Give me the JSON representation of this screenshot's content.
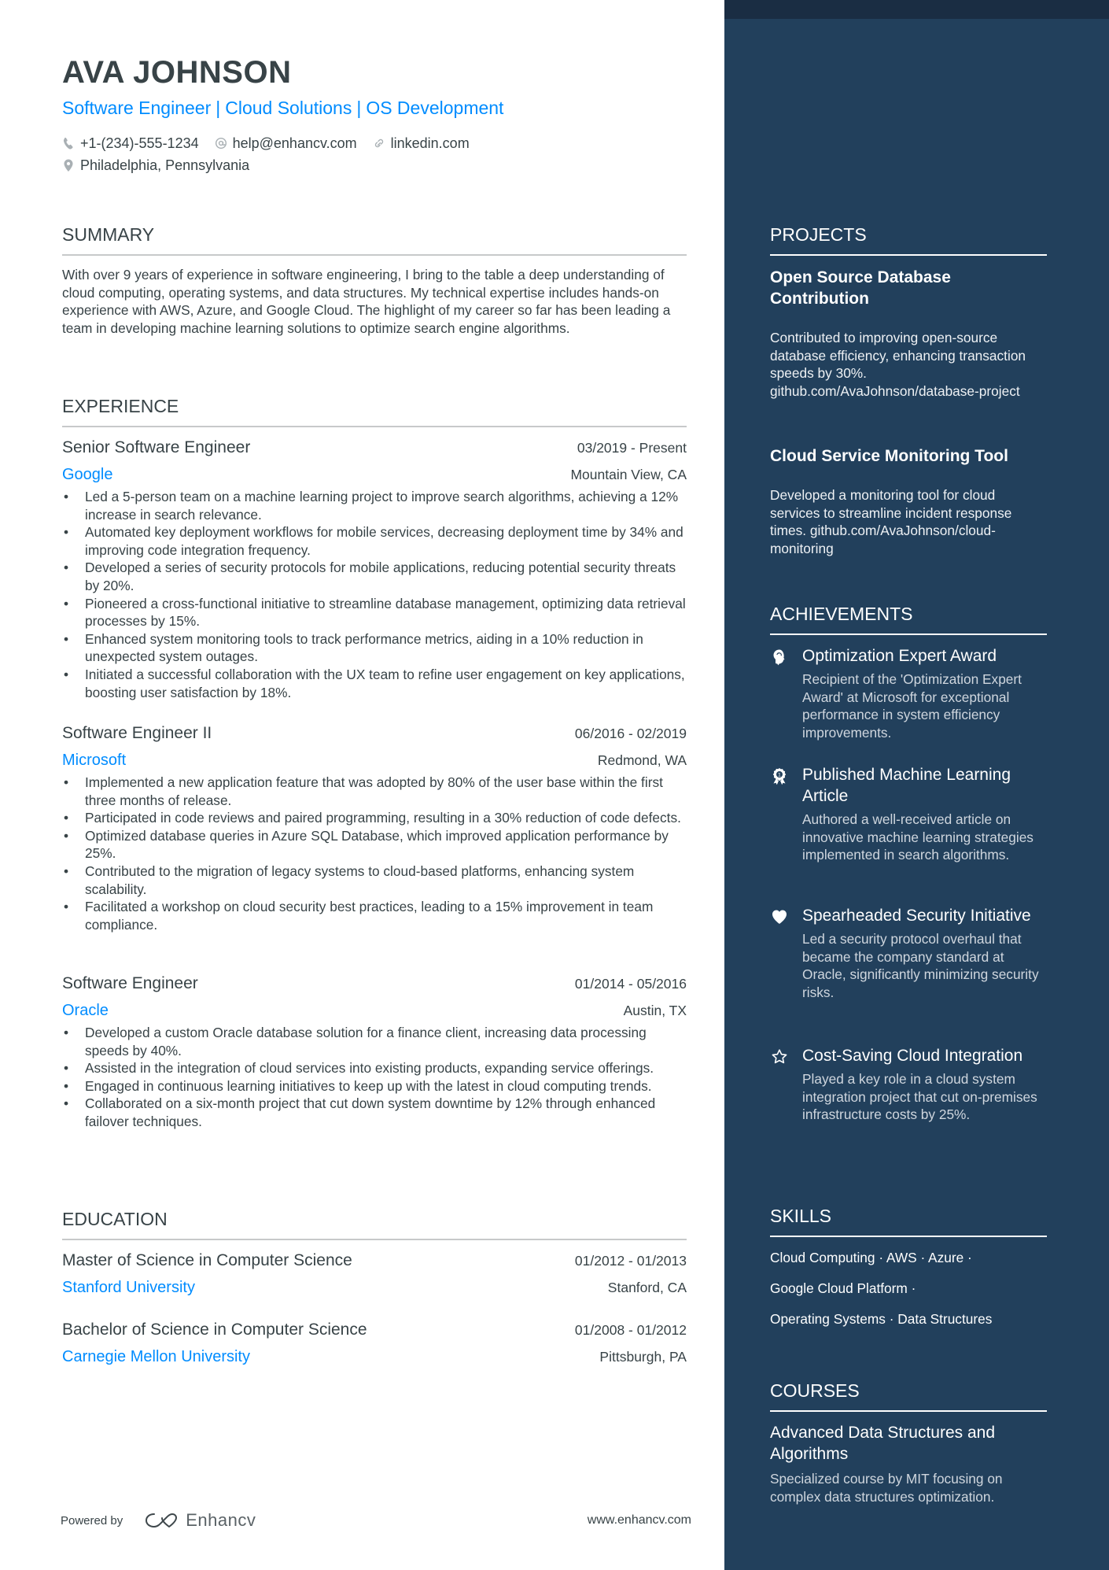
{
  "header": {
    "name": "AVA JOHNSON",
    "title_parts": [
      "Software Engineer",
      "Cloud Solutions",
      "OS Development"
    ],
    "title_separator": "|",
    "contacts": {
      "phone": "+1-(234)-555-1234",
      "email": "help@enhancv.com",
      "linkedin": "linkedin.com",
      "location": "Philadelphia, Pennsylvania"
    },
    "icons": [
      "phone-icon",
      "at-icon",
      "link-icon",
      "location-pin-icon"
    ]
  },
  "summary": {
    "heading": "SUMMARY",
    "text": "With over 9 years of experience in software engineering, I bring to the table a deep understanding of cloud computing, operating systems, and data structures. My technical expertise includes hands-on experience with AWS, Azure, and Google Cloud. The highlight of my career so far has been leading a team in developing machine learning solutions to optimize search engine algorithms."
  },
  "experience": {
    "heading": "EXPERIENCE",
    "jobs": [
      {
        "role": "Senior Software Engineer",
        "dates": "03/2019 - Present",
        "company": "Google",
        "location": "Mountain View, CA",
        "bullets": [
          "Led a 5-person team on a machine learning project to improve search algorithms, achieving a 12% increase in search relevance.",
          "Automated key deployment workflows for mobile services, decreasing deployment time by 34% and improving code integration frequency.",
          "Developed a series of security protocols for mobile applications, reducing potential security threats by 20%.",
          "Pioneered a cross-functional initiative to streamline database management, optimizing data retrieval processes by 15%.",
          "Enhanced system monitoring tools to track performance metrics, aiding in a 10% reduction in unexpected system outages.",
          "Initiated a successful collaboration with the UX team to refine user engagement on key applications, boosting user satisfaction by 18%."
        ]
      },
      {
        "role": "Software Engineer II",
        "dates": "06/2016 - 02/2019",
        "company": "Microsoft",
        "location": "Redmond, WA",
        "bullets": [
          "Implemented a new application feature that was adopted by 80% of the user base within the first three months of release.",
          "Participated in code reviews and paired programming, resulting in a 30% reduction of code defects.",
          "Optimized database queries in Azure SQL Database, which improved application performance by 25%.",
          "Contributed to the migration of legacy systems to cloud-based platforms, enhancing system scalability.",
          "Facilitated a workshop on cloud security best practices, leading to a 15% improvement in team compliance."
        ]
      },
      {
        "role": "Software Engineer",
        "dates": "01/2014 - 05/2016",
        "company": "Oracle",
        "location": "Austin, TX",
        "bullets": [
          "Developed a custom Oracle database solution for a finance client, increasing data processing speeds by 40%.",
          "Assisted in the integration of cloud services into existing products, expanding service offerings.",
          "Engaged in continuous learning initiatives to keep up with the latest in cloud computing trends.",
          "Collaborated on a six-month project that cut down system downtime by 12% through enhanced failover techniques."
        ]
      }
    ]
  },
  "education": {
    "heading": "EDUCATION",
    "items": [
      {
        "degree": "Master of Science in Computer Science",
        "dates": "01/2012 - 01/2013",
        "school": "Stanford University",
        "location": "Stanford, CA"
      },
      {
        "degree": "Bachelor of Science in Computer Science",
        "dates": "01/2008 - 01/2012",
        "school": "Carnegie Mellon University",
        "location": "Pittsburgh, PA"
      }
    ]
  },
  "footer": {
    "powered_by": "Powered by",
    "brand": "Enhancv",
    "website": "www.enhancv.com"
  },
  "sidebar": {
    "projects": {
      "heading": "PROJECTS",
      "items": [
        {
          "title": "Open Source Database Contribution",
          "description": "Contributed to improving open-source database efficiency, enhancing transaction speeds by 30%. github.com/AvaJohnson/database-project"
        },
        {
          "title": "Cloud Service Monitoring Tool",
          "description": "Developed a monitoring tool for cloud services to streamline incident response times. github.com/AvaJohnson/cloud-monitoring"
        }
      ]
    },
    "achievements": {
      "heading": "ACHIEVEMENTS",
      "items": [
        {
          "icon": "brain-head-icon",
          "title": "Optimization Expert Award",
          "description": "Recipient of the 'Optimization Expert Award' at Microsoft for exceptional performance in system efficiency improvements."
        },
        {
          "icon": "award-medal-icon",
          "title": "Published Machine Learning Article",
          "description": "Authored a well-received article on innovative machine learning strategies implemented in search algorithms."
        },
        {
          "icon": "heart-icon",
          "title": "Spearheaded Security Initiative",
          "description": "Led a security protocol overhaul that became the company standard at Oracle, significantly minimizing security risks."
        },
        {
          "icon": "star-icon",
          "title": "Cost-Saving Cloud Integration",
          "description": "Played a key role in a cloud system integration project that cut on-premises infrastructure costs by 25%."
        }
      ]
    },
    "skills": {
      "heading": "SKILLS",
      "lines": [
        "Cloud Computing · AWS · Azure ·",
        "Google Cloud Platform ·",
        "Operating Systems · Data Structures"
      ]
    },
    "courses": {
      "heading": "COURSES",
      "items": [
        {
          "title": "Advanced Data Structures and Algorithms",
          "description": "Specialized course by MIT focusing on complex data structures optimization."
        }
      ]
    }
  },
  "colors": {
    "accent": "#008cff",
    "text": "#384347",
    "sidebar_bg": "#22405c",
    "sidebar_top": "#1a2d43",
    "rule": "#c7c9ca",
    "icon_gray": "#a9b0b4"
  }
}
